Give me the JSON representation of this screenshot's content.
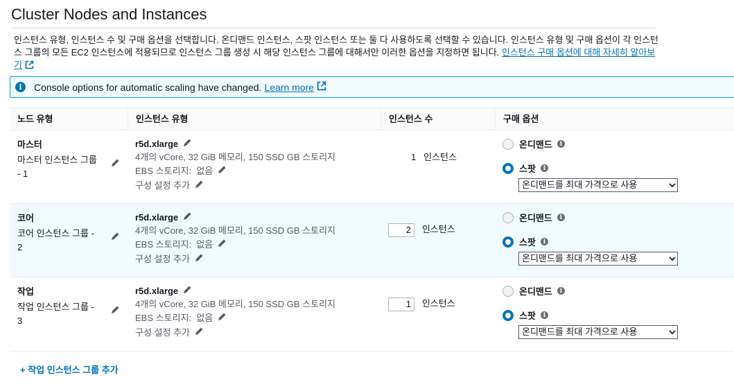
{
  "page": {
    "title": "Cluster Nodes and Instances",
    "description": "인스턴스 유형, 인스턴스 수 및 구매 옵션을 선택합니다. 온디맨드 인스턴스, 스팟 인스턴스 또는 둘 다 사용하도록 선택할 수 있습니다. 인스턴스 유형 및 구매 옵션이 각 인스턴스 그룹의 모든 EC2 인스턴스에 적용되므로 인스턴스 그룹 생성 시 해당 인스턴스 그룹에 대해서만 이러한 옵션을 지정하면 됩니다.",
    "description_link": "인스턴스 구매 옵션에 대해 자세히 알아보기"
  },
  "alert": {
    "message": "Console options for automatic scaling have changed.",
    "link": "Learn more"
  },
  "table": {
    "headers": [
      "노드 유형",
      "인스턴스 유형",
      "인스턴스 수",
      "구매 옵션"
    ],
    "rows": [
      {
        "node_type": "마스터",
        "group_name": "마스터 인스턴스 그룹 - 1",
        "instance_type": "r5d.xlarge",
        "specs": "4개의 vCore, 32 GiB 메모리, 150 SSD GB 스토리지",
        "ebs_label": "EBS 스토리지:",
        "ebs_value": "없음",
        "config": "구성 설정 추가",
        "count": "1",
        "count_unit": "인스턴스",
        "on_demand": "온디맨드",
        "spot": "스팟",
        "spot_selected": true,
        "max_price": "온디맨드를 최대 가격으로 사용"
      },
      {
        "node_type": "코어",
        "group_name": "코어 인스턴스 그룹 - 2",
        "instance_type": "r5d.xlarge",
        "specs": "4개의 vCore, 32 GiB 메모리, 150 SSD GB 스토리지",
        "ebs_label": "EBS 스토리지:",
        "ebs_value": "없음",
        "config": "구성 설정 추가",
        "count": "2",
        "count_unit": "인스턴스",
        "on_demand": "온디맨드",
        "spot": "스팟",
        "spot_selected": true,
        "max_price": "온디맨드를 최대 가격으로 사용"
      },
      {
        "node_type": "작업",
        "group_name": "작업 인스턴스 그룹 - 3",
        "instance_type": "r5d.xlarge",
        "specs": "4개의 vCore, 32 GiB 메모리, 150 SSD GB 스토리지",
        "ebs_label": "EBS 스토리지:",
        "ebs_value": "없음",
        "config": "구성 설정 추가",
        "count": "1",
        "count_unit": "인스턴스",
        "on_demand": "온디맨드",
        "spot": "스팟",
        "spot_selected": true,
        "max_price": "온디맨드를 최대 가격으로 사용"
      }
    ]
  },
  "add_group": "+ 작업 인스턴스 그룹 추가",
  "icons": {
    "edit": "pencil-icon",
    "info": "info-icon",
    "external": "external-link-icon"
  },
  "colors": {
    "link": "#0073bb",
    "alert_bg": "#f1faff",
    "alert_border": "#00a1c9",
    "row_highlight": "#f1faff"
  }
}
